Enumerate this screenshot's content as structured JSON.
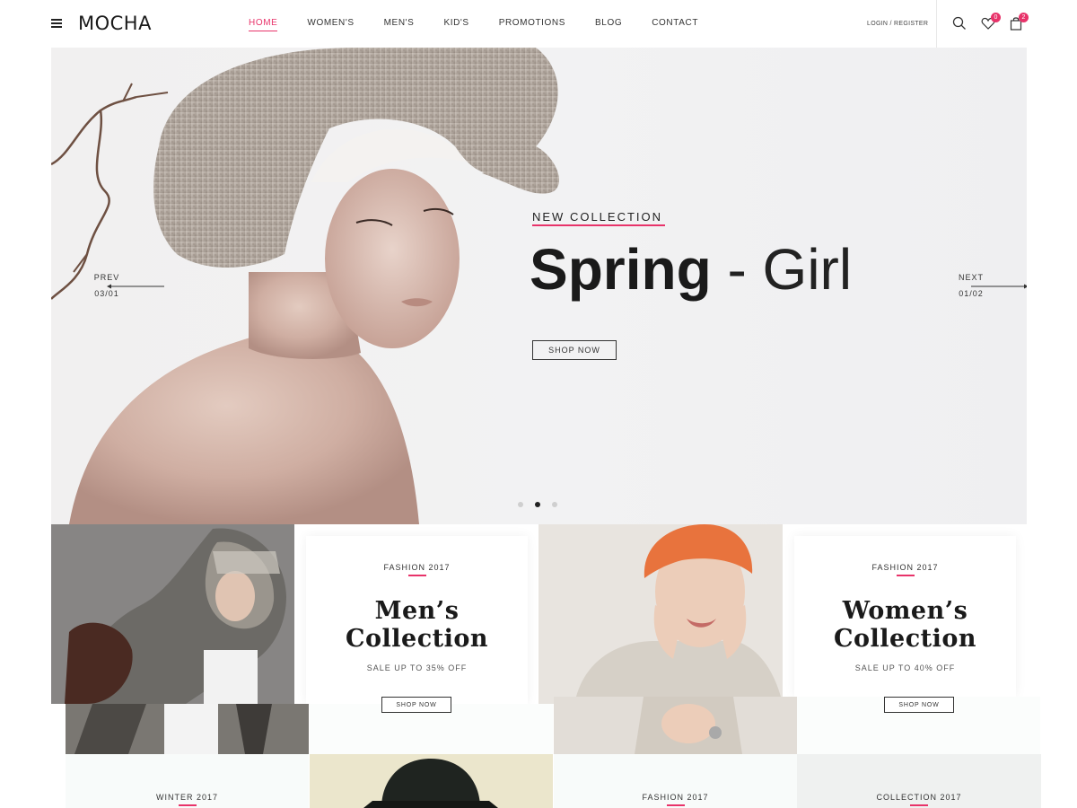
{
  "brand": {
    "logo": "MOCHA",
    "accent": "#e8336a"
  },
  "nav": {
    "items": [
      "HOME",
      "WOMEN'S",
      "MEN'S",
      "KID'S",
      "PROMOTIONS",
      "BLOG",
      "CONTACT"
    ],
    "active": "HOME"
  },
  "header": {
    "login": "LOGIN / REGISTER",
    "wishlist_count": "0",
    "cart_count": "2",
    "icons": [
      "menu-icon",
      "search-icon",
      "heart-icon",
      "bag-icon"
    ]
  },
  "hero": {
    "eyebrow": "NEW COLLECTION",
    "title_bold": "Spring",
    "title_light": " - Girl",
    "button": "SHOP NOW",
    "prev_label": "PREV",
    "prev_num": "03/01",
    "next_label": "NEXT",
    "next_num": "01/02",
    "slides": 3,
    "active_slide": 2
  },
  "collections": [
    {
      "eyebrow": "FASHION 2017",
      "title_line1": "Men’s",
      "title_line2": "Collection",
      "sale": "SALE UP TO 35% OFF",
      "button": "SHOP NOW"
    },
    {
      "eyebrow": "FASHION 2017",
      "title_line1": "Women’s",
      "title_line2": "Collection",
      "sale": "SALE UP TO 40% OFF",
      "button": "SHOP NOW"
    }
  ],
  "row3": [
    "WINTER 2017",
    "FASHION 2017",
    "COLLECTION 2017"
  ]
}
